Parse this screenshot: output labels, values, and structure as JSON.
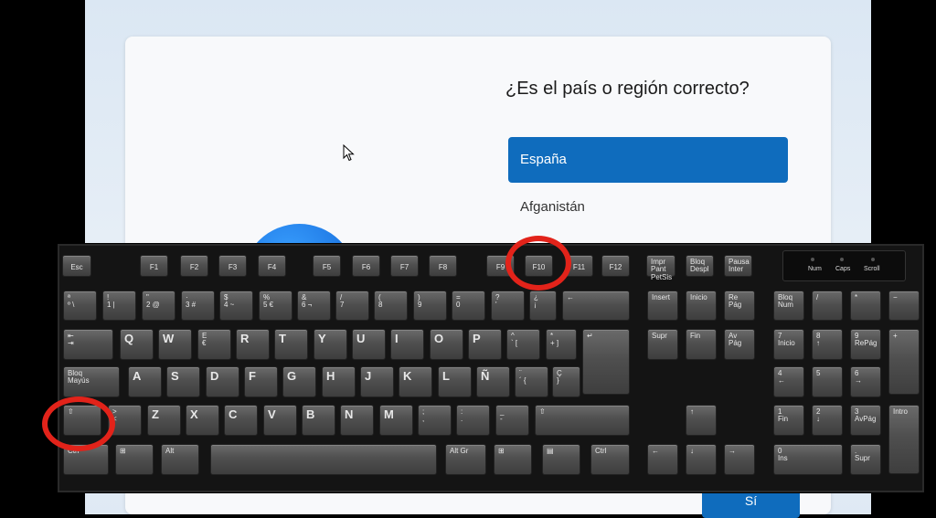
{
  "setup": {
    "question": "¿Es el país o región correcto?",
    "selected_option": "España",
    "next_option": "Afganistán",
    "yes_button": "Sí"
  },
  "keyboard": {
    "indicators": [
      "Num",
      "Caps",
      "Scroll"
    ],
    "keys": [
      {
        "label": "Esc"
      },
      {
        "label": "F1"
      },
      {
        "label": "F2"
      },
      {
        "label": "F3"
      },
      {
        "label": "F4"
      },
      {
        "label": "F5"
      },
      {
        "label": "F6"
      },
      {
        "label": "F7"
      },
      {
        "label": "F8"
      },
      {
        "label": "F9"
      },
      {
        "label": "F10"
      },
      {
        "label": "F11"
      },
      {
        "label": "F12"
      },
      {
        "label": "Impr\nPant\nPetSis"
      },
      {
        "label": "Bloq\nDespl"
      },
      {
        "label": "Pausa\nInter"
      },
      {
        "label": "ª\nº \\"
      },
      {
        "label": "!\n1 |"
      },
      {
        "label": "\"\n2 @"
      },
      {
        "label": "·\n3 #"
      },
      {
        "label": "$\n4 ~"
      },
      {
        "label": "%\n5 €"
      },
      {
        "label": "&\n6 ¬"
      },
      {
        "label": "/\n7"
      },
      {
        "label": "(\n8"
      },
      {
        "label": ")\n9"
      },
      {
        "label": "=\n0"
      },
      {
        "label": "?\n'"
      },
      {
        "label": "¿\n¡"
      },
      {
        "label": "←"
      },
      {
        "label": "Insert"
      },
      {
        "label": "Inicio"
      },
      {
        "label": "Re\nPág"
      },
      {
        "label": "Bloq\nNum"
      },
      {
        "label": "/"
      },
      {
        "label": "*"
      },
      {
        "label": "−"
      },
      {
        "label": "⇤\n⇥"
      },
      {
        "label": "Q"
      },
      {
        "label": "W"
      },
      {
        "label": "E\n€"
      },
      {
        "label": "R"
      },
      {
        "label": "T"
      },
      {
        "label": "Y"
      },
      {
        "label": "U"
      },
      {
        "label": "I"
      },
      {
        "label": "O"
      },
      {
        "label": "P"
      },
      {
        "label": "^\n` ["
      },
      {
        "label": "*\n+ ]"
      },
      {
        "label": "↵"
      },
      {
        "label": "Supr"
      },
      {
        "label": "Fin"
      },
      {
        "label": "Av\nPág"
      },
      {
        "label": "7\nInicio"
      },
      {
        "label": "8\n↑"
      },
      {
        "label": "9\nRePág"
      },
      {
        "label": "+"
      },
      {
        "label": "Bloq\nMayús"
      },
      {
        "label": "A"
      },
      {
        "label": "S"
      },
      {
        "label": "D"
      },
      {
        "label": "F"
      },
      {
        "label": "G"
      },
      {
        "label": "H"
      },
      {
        "label": "J"
      },
      {
        "label": "K"
      },
      {
        "label": "L"
      },
      {
        "label": "Ñ"
      },
      {
        "label": "¨\n´ {"
      },
      {
        "label": "Ç\n}"
      },
      {
        "label": "4\n←"
      },
      {
        "label": "5"
      },
      {
        "label": "6\n→"
      },
      {
        "label": "⇧"
      },
      {
        "label": ">\n<"
      },
      {
        "label": "Z"
      },
      {
        "label": "X"
      },
      {
        "label": "C"
      },
      {
        "label": "V"
      },
      {
        "label": "B"
      },
      {
        "label": "N"
      },
      {
        "label": "M"
      },
      {
        "label": ";\n,"
      },
      {
        "label": ":\n."
      },
      {
        "label": "_\n-"
      },
      {
        "label": "⇧"
      },
      {
        "label": "↑"
      },
      {
        "label": "1\nFin"
      },
      {
        "label": "2\n↓"
      },
      {
        "label": "3\nAvPág"
      },
      {
        "label": "Intro"
      },
      {
        "label": "Ctrl"
      },
      {
        "label": "⊞"
      },
      {
        "label": "Alt"
      },
      {
        "label": ""
      },
      {
        "label": "Alt Gr"
      },
      {
        "label": "⊞"
      },
      {
        "label": "▤"
      },
      {
        "label": "Ctrl"
      },
      {
        "label": "←"
      },
      {
        "label": "↓"
      },
      {
        "label": "→"
      },
      {
        "label": "0\nIns"
      },
      {
        "label": ".\nSupr"
      }
    ]
  },
  "colors": {
    "accent": "#0f6cbd",
    "highlight_circle": "#e2231a"
  }
}
